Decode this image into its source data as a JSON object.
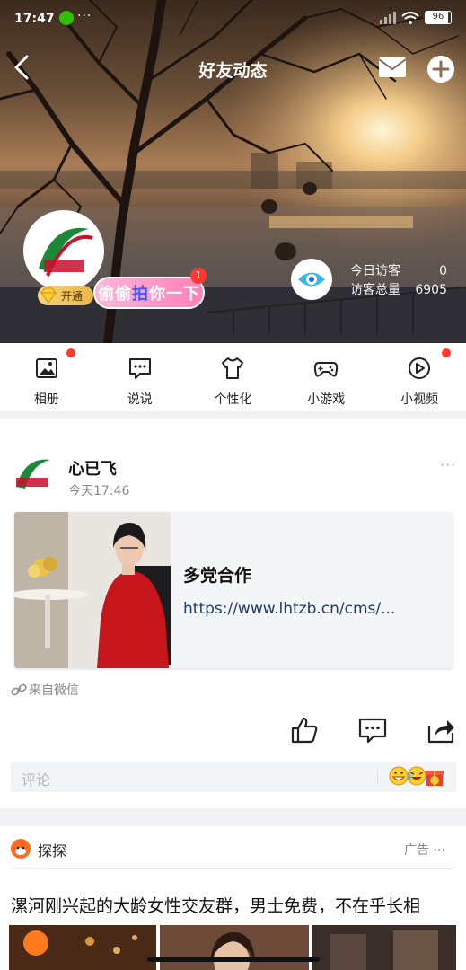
{
  "status_bar": {
    "time": "17:47",
    "more": "···",
    "battery": "96"
  },
  "nav": {
    "title": "好友动态"
  },
  "profile": {
    "vip_label": "开通",
    "sneak_text_before": "偷偷",
    "sneak_text_highlight": "拍",
    "sneak_text_after": "你一下",
    "sneak_count": "1",
    "visits_today_label": "今日访客",
    "visits_today_value": "0",
    "visits_total_label": "访客总量",
    "visits_total_value": "6905"
  },
  "shortcuts": [
    {
      "label": "相册",
      "icon": "photo-album-icon",
      "dot": true
    },
    {
      "label": "说说",
      "icon": "speech-bubble-icon",
      "dot": false
    },
    {
      "label": "个性化",
      "icon": "tshirt-icon",
      "dot": true
    },
    {
      "label": "小游戏",
      "icon": "gamepad-icon",
      "dot": true
    },
    {
      "label": "小视频",
      "icon": "play-video-icon",
      "dot": false
    }
  ],
  "post": {
    "user": "心已飞",
    "time": "今天17:46",
    "more": "···",
    "link_title": "多党合作",
    "link_url": "https://www.lhtzb.cn/cms/...",
    "source": "来自微信",
    "comment_placeholder": "评论"
  },
  "ad": {
    "name": "探探",
    "tag": "广告 ···",
    "text": "漯河刚兴起的大龄女性交友群，男士免费，不在乎长相"
  },
  "colors": {
    "accent_red": "#ff3b30",
    "link_blue": "#1d3d66",
    "vip_gold": "#f7d37a",
    "bubble_pink": "#ff7fb7"
  }
}
